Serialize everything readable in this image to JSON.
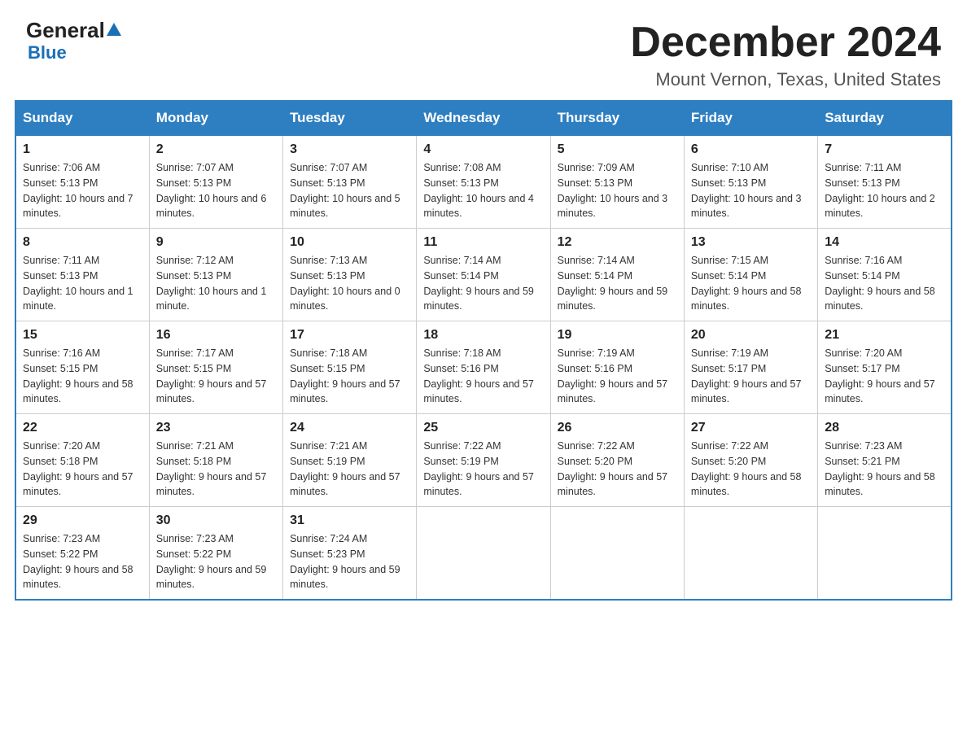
{
  "header": {
    "logo_general": "General",
    "logo_blue": "Blue",
    "month_title": "December 2024",
    "location": "Mount Vernon, Texas, United States"
  },
  "days_of_week": [
    "Sunday",
    "Monday",
    "Tuesday",
    "Wednesday",
    "Thursday",
    "Friday",
    "Saturday"
  ],
  "weeks": [
    [
      {
        "day": "1",
        "sunrise": "7:06 AM",
        "sunset": "5:13 PM",
        "daylight": "10 hours and 7 minutes."
      },
      {
        "day": "2",
        "sunrise": "7:07 AM",
        "sunset": "5:13 PM",
        "daylight": "10 hours and 6 minutes."
      },
      {
        "day": "3",
        "sunrise": "7:07 AM",
        "sunset": "5:13 PM",
        "daylight": "10 hours and 5 minutes."
      },
      {
        "day": "4",
        "sunrise": "7:08 AM",
        "sunset": "5:13 PM",
        "daylight": "10 hours and 4 minutes."
      },
      {
        "day": "5",
        "sunrise": "7:09 AM",
        "sunset": "5:13 PM",
        "daylight": "10 hours and 3 minutes."
      },
      {
        "day": "6",
        "sunrise": "7:10 AM",
        "sunset": "5:13 PM",
        "daylight": "10 hours and 3 minutes."
      },
      {
        "day": "7",
        "sunrise": "7:11 AM",
        "sunset": "5:13 PM",
        "daylight": "10 hours and 2 minutes."
      }
    ],
    [
      {
        "day": "8",
        "sunrise": "7:11 AM",
        "sunset": "5:13 PM",
        "daylight": "10 hours and 1 minute."
      },
      {
        "day": "9",
        "sunrise": "7:12 AM",
        "sunset": "5:13 PM",
        "daylight": "10 hours and 1 minute."
      },
      {
        "day": "10",
        "sunrise": "7:13 AM",
        "sunset": "5:13 PM",
        "daylight": "10 hours and 0 minutes."
      },
      {
        "day": "11",
        "sunrise": "7:14 AM",
        "sunset": "5:14 PM",
        "daylight": "9 hours and 59 minutes."
      },
      {
        "day": "12",
        "sunrise": "7:14 AM",
        "sunset": "5:14 PM",
        "daylight": "9 hours and 59 minutes."
      },
      {
        "day": "13",
        "sunrise": "7:15 AM",
        "sunset": "5:14 PM",
        "daylight": "9 hours and 58 minutes."
      },
      {
        "day": "14",
        "sunrise": "7:16 AM",
        "sunset": "5:14 PM",
        "daylight": "9 hours and 58 minutes."
      }
    ],
    [
      {
        "day": "15",
        "sunrise": "7:16 AM",
        "sunset": "5:15 PM",
        "daylight": "9 hours and 58 minutes."
      },
      {
        "day": "16",
        "sunrise": "7:17 AM",
        "sunset": "5:15 PM",
        "daylight": "9 hours and 57 minutes."
      },
      {
        "day": "17",
        "sunrise": "7:18 AM",
        "sunset": "5:15 PM",
        "daylight": "9 hours and 57 minutes."
      },
      {
        "day": "18",
        "sunrise": "7:18 AM",
        "sunset": "5:16 PM",
        "daylight": "9 hours and 57 minutes."
      },
      {
        "day": "19",
        "sunrise": "7:19 AM",
        "sunset": "5:16 PM",
        "daylight": "9 hours and 57 minutes."
      },
      {
        "day": "20",
        "sunrise": "7:19 AM",
        "sunset": "5:17 PM",
        "daylight": "9 hours and 57 minutes."
      },
      {
        "day": "21",
        "sunrise": "7:20 AM",
        "sunset": "5:17 PM",
        "daylight": "9 hours and 57 minutes."
      }
    ],
    [
      {
        "day": "22",
        "sunrise": "7:20 AM",
        "sunset": "5:18 PM",
        "daylight": "9 hours and 57 minutes."
      },
      {
        "day": "23",
        "sunrise": "7:21 AM",
        "sunset": "5:18 PM",
        "daylight": "9 hours and 57 minutes."
      },
      {
        "day": "24",
        "sunrise": "7:21 AM",
        "sunset": "5:19 PM",
        "daylight": "9 hours and 57 minutes."
      },
      {
        "day": "25",
        "sunrise": "7:22 AM",
        "sunset": "5:19 PM",
        "daylight": "9 hours and 57 minutes."
      },
      {
        "day": "26",
        "sunrise": "7:22 AM",
        "sunset": "5:20 PM",
        "daylight": "9 hours and 57 minutes."
      },
      {
        "day": "27",
        "sunrise": "7:22 AM",
        "sunset": "5:20 PM",
        "daylight": "9 hours and 58 minutes."
      },
      {
        "day": "28",
        "sunrise": "7:23 AM",
        "sunset": "5:21 PM",
        "daylight": "9 hours and 58 minutes."
      }
    ],
    [
      {
        "day": "29",
        "sunrise": "7:23 AM",
        "sunset": "5:22 PM",
        "daylight": "9 hours and 58 minutes."
      },
      {
        "day": "30",
        "sunrise": "7:23 AM",
        "sunset": "5:22 PM",
        "daylight": "9 hours and 59 minutes."
      },
      {
        "day": "31",
        "sunrise": "7:24 AM",
        "sunset": "5:23 PM",
        "daylight": "9 hours and 59 minutes."
      },
      null,
      null,
      null,
      null
    ]
  ]
}
